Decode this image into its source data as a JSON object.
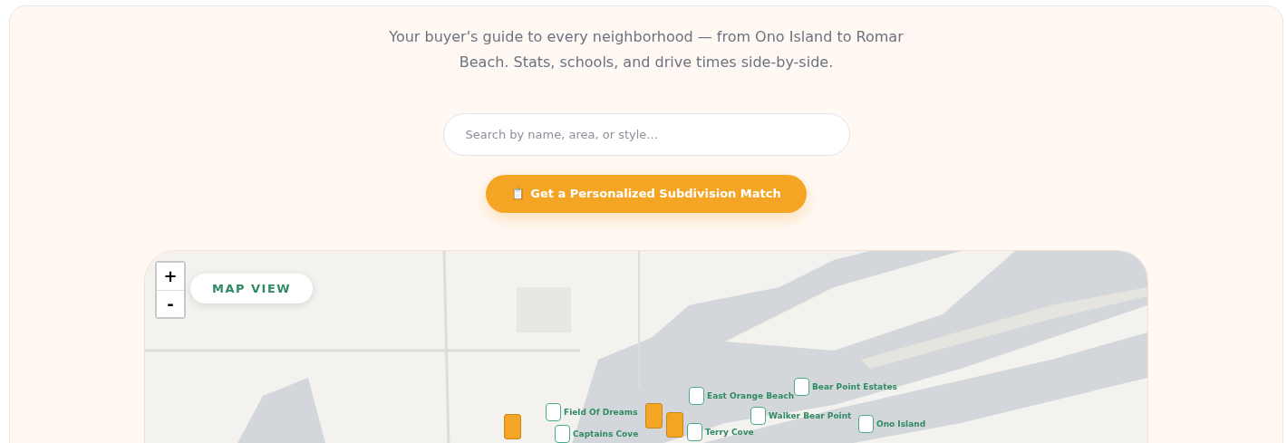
{
  "hero": {
    "subtitle": "Your buyer's guide to every neighborhood — from Ono Island to Romar Beach. Stats, schools, and drive times side-by-side.",
    "search": {
      "placeholder": "Search by name, area, or style..."
    },
    "cta": {
      "icon": "📋",
      "label": "Get a Personalized Subdivision Match"
    }
  },
  "map": {
    "zoom_in": "+",
    "zoom_out": "-",
    "badge": "MAP VIEW",
    "markers": [
      {
        "kind": "featured"
      },
      {
        "kind": "pin",
        "label": "Field Of Dreams"
      },
      {
        "kind": "pin",
        "label": "Captains Cove"
      },
      {
        "kind": "featured"
      },
      {
        "kind": "featured"
      },
      {
        "kind": "pin",
        "label": "East Orange Beach"
      },
      {
        "kind": "pin",
        "label": "Terry Cove"
      },
      {
        "kind": "pin",
        "label": "Walker Bear Point"
      },
      {
        "kind": "pin",
        "label": "Bear Point Estates"
      },
      {
        "kind": "pin",
        "label": "Ono Island"
      }
    ]
  }
}
